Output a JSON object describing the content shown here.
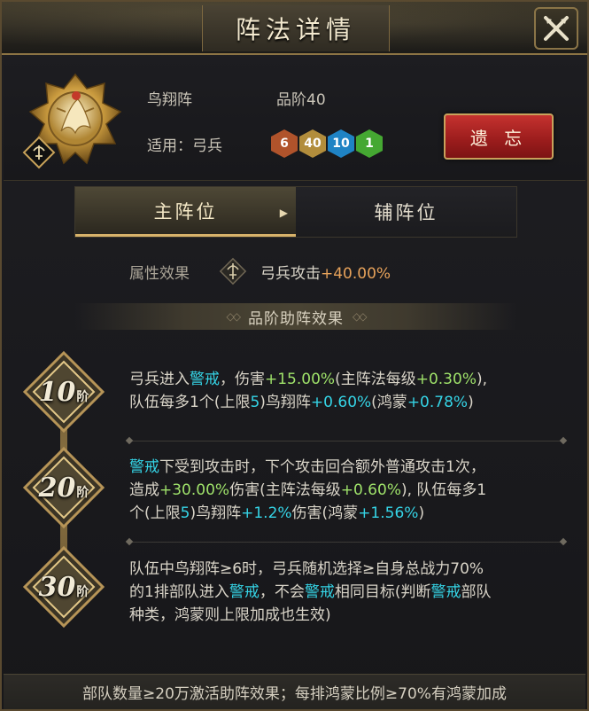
{
  "window": {
    "title": "阵法详情"
  },
  "formation": {
    "name": "鸟翔阵",
    "grade": "品阶40",
    "applicable": "适用：弓兵",
    "stats": [
      {
        "value": "6",
        "color": "#b0532b"
      },
      {
        "value": "40",
        "color": "#b28d3c"
      },
      {
        "value": "10",
        "color": "#1f83c4"
      },
      {
        "value": "1",
        "color": "#45a832"
      }
    ],
    "forget_label": "遗 忘"
  },
  "tabs": [
    {
      "label": "主阵位",
      "active": true
    },
    {
      "label": "辅阵位",
      "active": false
    }
  ],
  "attribute": {
    "label": "属性效果",
    "text": "弓兵攻击",
    "value": "+40.00%",
    "icon": "bow-icon"
  },
  "section": {
    "title": "品阶助阵效果"
  },
  "tiers": [
    {
      "level": "10",
      "unit": "阶",
      "parts": [
        [
          "弓兵进入",
          "w"
        ],
        [
          "警戒",
          "c"
        ],
        [
          "，伤害",
          "w"
        ],
        [
          "+15.00%",
          "g"
        ],
        [
          "(主阵法每级",
          "w"
        ],
        [
          "+0.30%",
          "g"
        ],
        [
          "),",
          "w"
        ],
        [
          "\n",
          "br"
        ],
        [
          "队伍每多1个(上限",
          "w"
        ],
        [
          "5",
          "c"
        ],
        [
          ")鸟翔阵",
          "w"
        ],
        [
          "+0.60%",
          "c"
        ],
        [
          "(鸿蒙",
          "w"
        ],
        [
          "+0.78%",
          "c"
        ],
        [
          ")",
          "w"
        ]
      ]
    },
    {
      "level": "20",
      "unit": "阶",
      "parts": [
        [
          "警戒",
          "c"
        ],
        [
          "下受到攻击时，下个攻击回合额外普通攻击1次，",
          "w"
        ],
        [
          "\n",
          "br"
        ],
        [
          "造成",
          "w"
        ],
        [
          "+30.00%",
          "g"
        ],
        [
          "伤害(主阵法每级",
          "w"
        ],
        [
          "+0.60%",
          "g"
        ],
        [
          "), 队伍每多1",
          "w"
        ],
        [
          "\n",
          "br"
        ],
        [
          "个(上限",
          "w"
        ],
        [
          "5",
          "c"
        ],
        [
          ")鸟翔阵",
          "w"
        ],
        [
          "+1.2%",
          "c"
        ],
        [
          "伤害(鸿蒙",
          "w"
        ],
        [
          "+1.56%",
          "c"
        ],
        [
          ")",
          "w"
        ]
      ]
    },
    {
      "level": "30",
      "unit": "阶",
      "parts": [
        [
          "队伍中鸟翔阵≥6时，弓兵随机选择≥自身总战力70%",
          "w"
        ],
        [
          "\n",
          "br"
        ],
        [
          "的1排部队进入",
          "w"
        ],
        [
          "警戒",
          "c"
        ],
        [
          "，不会",
          "w"
        ],
        [
          "警戒",
          "c"
        ],
        [
          "相同目标(判断",
          "w"
        ],
        [
          "警戒",
          "c"
        ],
        [
          "部队",
          "w"
        ],
        [
          "\n",
          "br"
        ],
        [
          "种类，鸿蒙则上限加成也生效)",
          "w"
        ]
      ]
    }
  ],
  "footer": {
    "text": "部队数量≥20万激活助阵效果；每排鸿蒙比例≥70%有鸿蒙加成"
  },
  "colors": {
    "cyan": "#35d4e6",
    "green": "#9fe26a",
    "orange": "#e7a25a",
    "gold": "#d7b26a"
  }
}
